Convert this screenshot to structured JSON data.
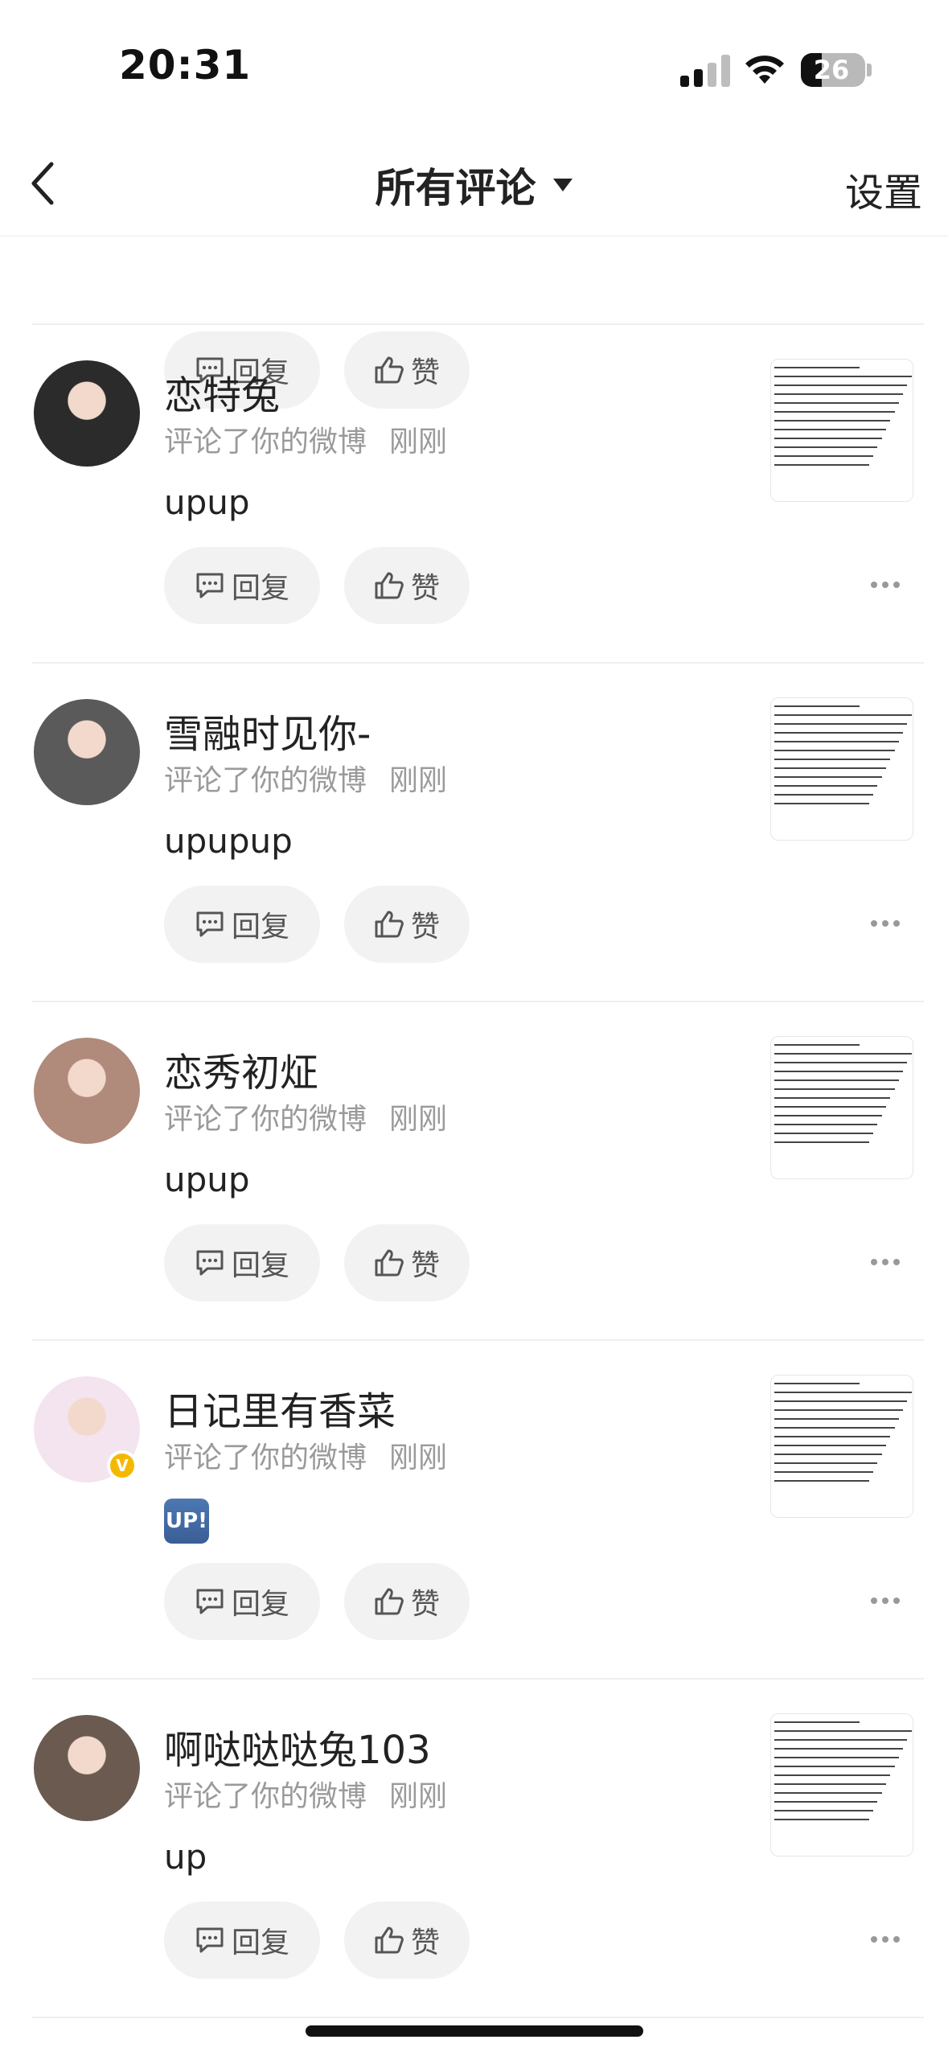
{
  "status_bar": {
    "time": "20:31",
    "battery": "26",
    "battery_level": 0.26
  },
  "nav": {
    "title": "所有评论",
    "settings": "设置"
  },
  "labels": {
    "reply": "回复",
    "like": "赞"
  },
  "comments": [
    {
      "username": "恋特兔",
      "action": "评论了你的微博",
      "time": "刚刚",
      "body": "upup",
      "verified": false,
      "avatar_color": "#2b2b2b"
    },
    {
      "username": "雪融时见你-",
      "action": "评论了你的微博",
      "time": "刚刚",
      "body": "upupup",
      "verified": false,
      "avatar_color": "#5a5a5a"
    },
    {
      "username": "恋秀初炡",
      "action": "评论了你的微博",
      "time": "刚刚",
      "body": "upup",
      "verified": false,
      "avatar_color": "#b08a7a"
    },
    {
      "username": "日记里有香菜",
      "action": "评论了你的微博",
      "time": "刚刚",
      "body": "UP!",
      "body_is_emoji": true,
      "verified": true,
      "avatar_color": "#f3e4ef"
    },
    {
      "username": "啊哒哒哒兔103",
      "action": "评论了你的微博",
      "time": "刚刚",
      "body": "up",
      "verified": false,
      "avatar_color": "#6b5a50"
    }
  ],
  "colors": {
    "accent_verified": "#f5b800",
    "button_bg": "#f2f2f2",
    "meta_text": "#9a9a9a"
  }
}
